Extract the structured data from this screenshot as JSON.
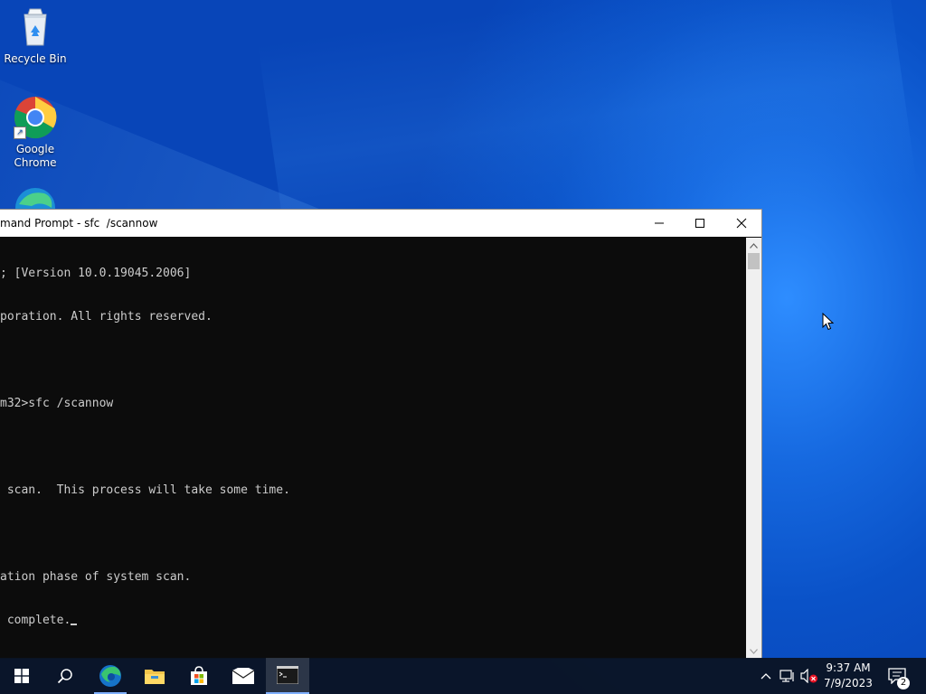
{
  "desktop": {
    "icons": [
      {
        "label": "Recycle Bin",
        "icon": "recycle-bin-icon"
      },
      {
        "label": "Google\nChrome",
        "icon": "chrome-icon"
      },
      {
        "label": "",
        "icon": "edge-icon"
      }
    ]
  },
  "window": {
    "title": "mand Prompt - sfc  /scannow",
    "controls": {
      "minimize": "minimize-icon",
      "maximize": "maximize-icon",
      "close": "close-icon"
    },
    "console_lines": [
      "; [Version 10.0.19045.2006]",
      "poration. All rights reserved.",
      "",
      "m32>sfc /scannow",
      "",
      " scan.  This process will take some time.",
      "",
      "ation phase of system scan.",
      " complete."
    ]
  },
  "taskbar": {
    "buttons": [
      "start-icon",
      "search-icon",
      "edge-icon",
      "file-explorer-icon",
      "store-icon",
      "mail-icon",
      "command-prompt-icon"
    ],
    "tray": [
      "chevron-up-icon",
      "network-icon",
      "volume-muted-icon",
      "notifications-icon"
    ],
    "time": "9:37 AM",
    "date": "7/9/2023",
    "notification_count": "2"
  },
  "colors": {
    "console_bg": "#0c0c0c",
    "console_text": "#cccccc",
    "taskbar_bg": "#0a1424",
    "desktop_accent": "#1669e0"
  }
}
